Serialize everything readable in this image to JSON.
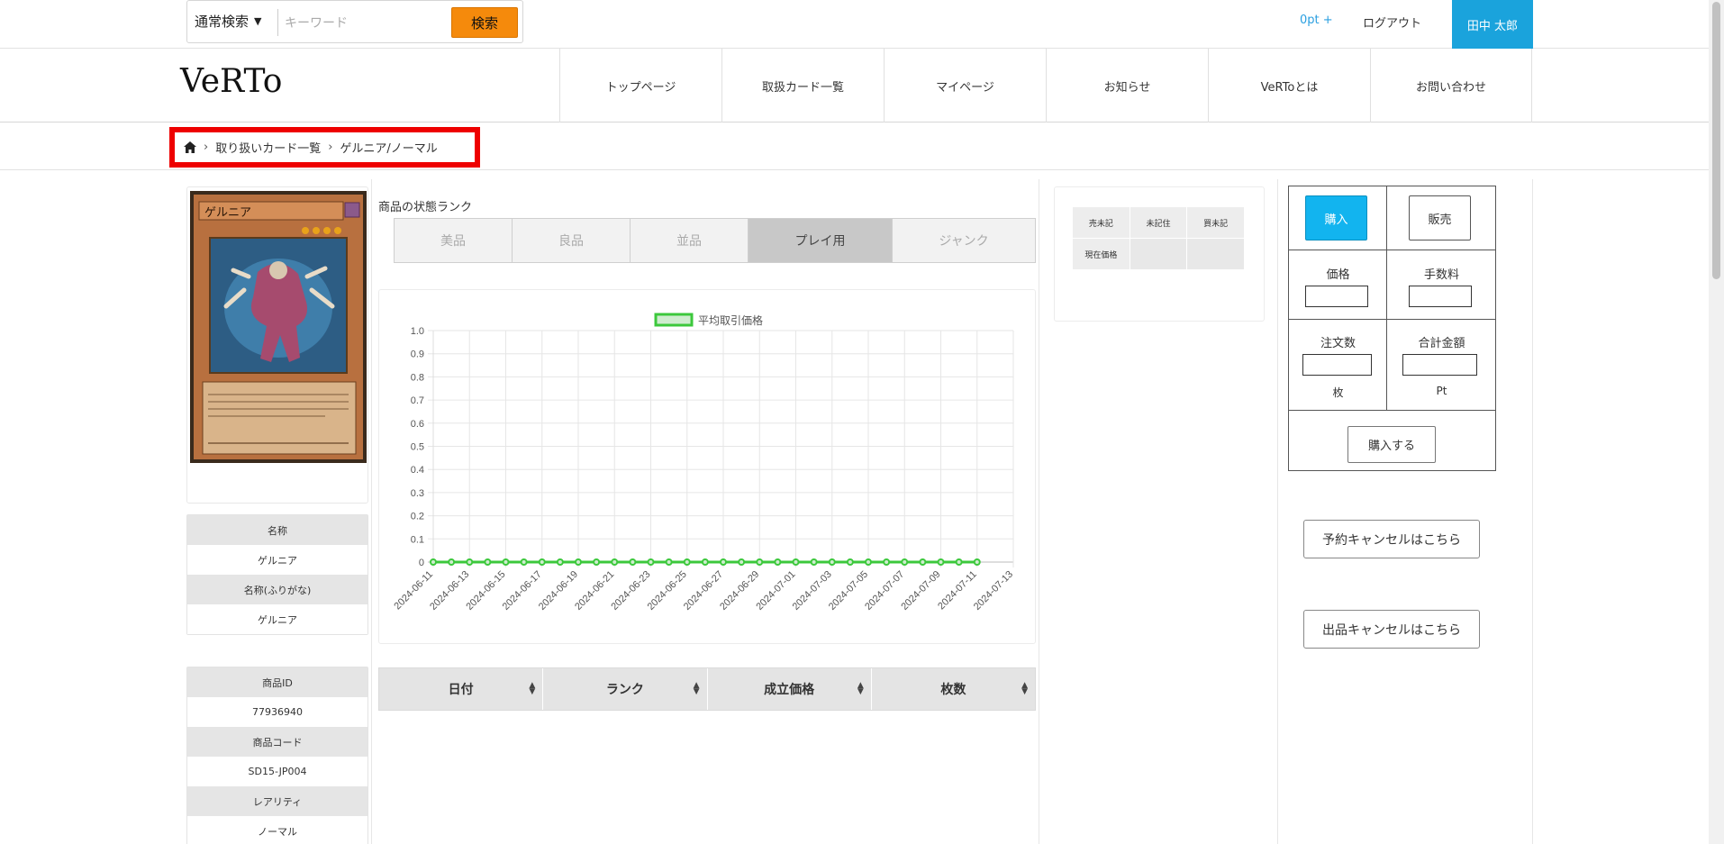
{
  "topbar": {
    "search_mode": "通常検索",
    "search_placeholder": "キーワード",
    "search_button": "検索",
    "points": "0pt +",
    "logout": "ログアウト",
    "user_name": "田中 太郎"
  },
  "header": {
    "logo": "VeRTo",
    "nav": [
      "トップページ",
      "取扱カード一覧",
      "マイページ",
      "お知らせ",
      "VeRToとは",
      "お問い合わせ"
    ]
  },
  "breadcrumb": {
    "items": [
      "取り扱いカード一覧",
      "ゲルニア/ノーマル"
    ]
  },
  "card": {
    "name_label": "名称",
    "name": "ゲルニア",
    "kana_label": "名称(ふりがな)",
    "kana": "ゲルニア",
    "id_label": "商品ID",
    "id": "77936940",
    "code_label": "商品コード",
    "code": "SD15-JP004",
    "rarity_label": "レアリティ",
    "rarity": "ノーマル"
  },
  "rank": {
    "label": "商品の状態ランク",
    "tabs": [
      "美品",
      "良品",
      "並品",
      "プレイ用",
      "ジャンク"
    ],
    "active_index": 3
  },
  "chart_data": {
    "type": "line",
    "legend": [
      "平均取引価格"
    ],
    "legend_placement": "top-center",
    "x": [
      "2024-06-11",
      "2024-06-12",
      "2024-06-13",
      "2024-06-14",
      "2024-06-15",
      "2024-06-16",
      "2024-06-17",
      "2024-06-18",
      "2024-06-19",
      "2024-06-20",
      "2024-06-21",
      "2024-06-22",
      "2024-06-23",
      "2024-06-24",
      "2024-06-25",
      "2024-06-26",
      "2024-06-27",
      "2024-06-28",
      "2024-06-29",
      "2024-06-30",
      "2024-07-01",
      "2024-07-02",
      "2024-07-03",
      "2024-07-04",
      "2024-07-05",
      "2024-07-06",
      "2024-07-07",
      "2024-07-08",
      "2024-07-09",
      "2024-07-10",
      "2024-07-11",
      "2024-07-12",
      "2024-07-13"
    ],
    "x_tick_labels": [
      "2024-06-11",
      "2024-06-13",
      "2024-06-15",
      "2024-06-17",
      "2024-06-19",
      "2024-06-21",
      "2024-06-23",
      "2024-06-25",
      "2024-06-27",
      "2024-06-29",
      "2024-07-01",
      "2024-07-03",
      "2024-07-05",
      "2024-07-07",
      "2024-07-09",
      "2024-07-11",
      "2024-07-13"
    ],
    "series": [
      {
        "name": "平均取引価格",
        "values": [
          0,
          0,
          0,
          0,
          0,
          0,
          0,
          0,
          0,
          0,
          0,
          0,
          0,
          0,
          0,
          0,
          0,
          0,
          0,
          0,
          0,
          0,
          0,
          0,
          0,
          0,
          0,
          0,
          0,
          0,
          0
        ]
      }
    ],
    "y_ticks": [
      "0",
      "0.1",
      "0.2",
      "0.3",
      "0.4",
      "0.5",
      "0.6",
      "0.7",
      "0.8",
      "0.9",
      "1.0"
    ],
    "ylim": [
      0,
      1.0
    ],
    "grid": true,
    "line_color": "#3cc83c",
    "legend_fill": "#cfeccf"
  },
  "history": {
    "headers": [
      "日付",
      "ランク",
      "成立価格",
      "枚数"
    ]
  },
  "price_table": {
    "headers": [
      "売未記",
      "未記住",
      "買未記"
    ],
    "row_label": "現在価格"
  },
  "order": {
    "buy_tab": "購入",
    "sell_tab": "販売",
    "price_label": "価格",
    "fee_label": "手数料",
    "qty_label": "注文数",
    "total_label": "合計金額",
    "qty_unit": "枚",
    "total_unit": "Pt",
    "submit": "購入する",
    "reservation_cancel": "予約キャンセルはこちら",
    "listing_cancel": "出品キャンセルはこちら",
    "buy_color": "#12b4ef"
  }
}
